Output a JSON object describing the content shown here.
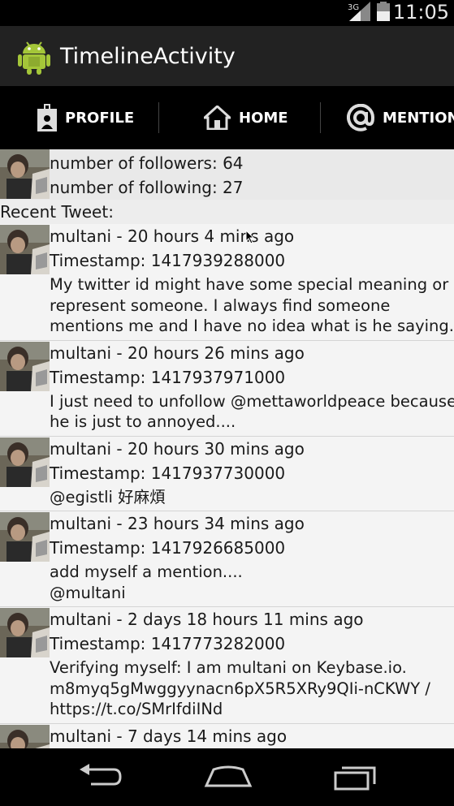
{
  "status_bar": {
    "network": "3G",
    "time": "11:05"
  },
  "action_bar": {
    "title": "TimelineActivity"
  },
  "tabs": [
    {
      "label": "PROFILE",
      "icon": "profile-icon",
      "selected": true
    },
    {
      "label": "HOME",
      "icon": "home-icon",
      "selected": false
    },
    {
      "label": "MENTIONS",
      "icon": "at-icon",
      "selected": false
    }
  ],
  "profile": {
    "followers": "number of followers: 64",
    "following": "number of following: 27",
    "recent_label": "Recent Tweet:"
  },
  "tweets": [
    {
      "header": "multani - 20 hours 4 mins ago",
      "timestamp": "Timestamp: 1417939288000",
      "text": "My twitter id might have some special meaning or\nrepresent someone. I always find someone\nmentions me and I have no idea what is he saying."
    },
    {
      "header": "multani - 20 hours 26 mins ago",
      "timestamp": "Timestamp: 1417937971000",
      "text": "I just need to unfollow @mettaworldpeace because\nhe is just to annoyed...."
    },
    {
      "header": "multani - 20 hours 30 mins ago",
      "timestamp": "Timestamp: 1417937730000",
      "text": "@egistli 好麻煩"
    },
    {
      "header": "multani - 23 hours 34 mins ago",
      "timestamp": "Timestamp: 1417926685000",
      "text": "add myself a mention....\n@multani"
    },
    {
      "header": "multani - 2 days 18 hours 11 mins ago",
      "timestamp": "Timestamp: 1417773282000",
      "text": "Verifying myself: I am multani on Keybase.io.\nm8myq5gMwggyynacn6pX5R5XRy9QIi-nCKWY /\nhttps://t.co/SMrIfdiINd"
    },
    {
      "header": "multani - 7 days 14 mins ago",
      "timestamp": "",
      "text": ""
    }
  ],
  "colors": {
    "accent": "#33b5e5",
    "action_bar": "#222222",
    "content_bg": "#f4f4f4"
  }
}
